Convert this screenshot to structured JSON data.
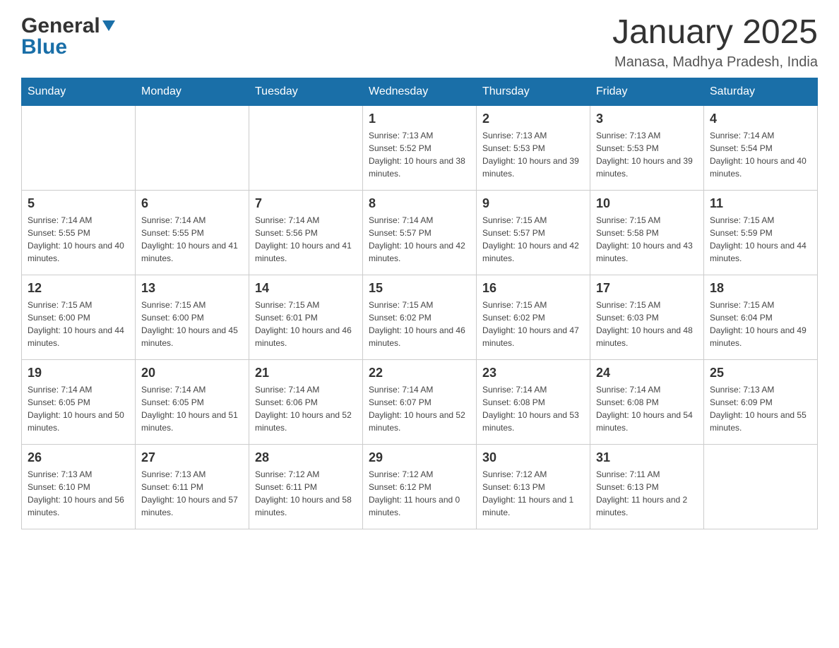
{
  "header": {
    "logo_general": "General",
    "logo_blue": "Blue",
    "month_title": "January 2025",
    "location": "Manasa, Madhya Pradesh, India"
  },
  "weekdays": [
    "Sunday",
    "Monday",
    "Tuesday",
    "Wednesday",
    "Thursday",
    "Friday",
    "Saturday"
  ],
  "weeks": [
    [
      null,
      null,
      null,
      {
        "day": 1,
        "sunrise": "7:13 AM",
        "sunset": "5:52 PM",
        "daylight": "10 hours and 38 minutes."
      },
      {
        "day": 2,
        "sunrise": "7:13 AM",
        "sunset": "5:53 PM",
        "daylight": "10 hours and 39 minutes."
      },
      {
        "day": 3,
        "sunrise": "7:13 AM",
        "sunset": "5:53 PM",
        "daylight": "10 hours and 39 minutes."
      },
      {
        "day": 4,
        "sunrise": "7:14 AM",
        "sunset": "5:54 PM",
        "daylight": "10 hours and 40 minutes."
      }
    ],
    [
      {
        "day": 5,
        "sunrise": "7:14 AM",
        "sunset": "5:55 PM",
        "daylight": "10 hours and 40 minutes."
      },
      {
        "day": 6,
        "sunrise": "7:14 AM",
        "sunset": "5:55 PM",
        "daylight": "10 hours and 41 minutes."
      },
      {
        "day": 7,
        "sunrise": "7:14 AM",
        "sunset": "5:56 PM",
        "daylight": "10 hours and 41 minutes."
      },
      {
        "day": 8,
        "sunrise": "7:14 AM",
        "sunset": "5:57 PM",
        "daylight": "10 hours and 42 minutes."
      },
      {
        "day": 9,
        "sunrise": "7:15 AM",
        "sunset": "5:57 PM",
        "daylight": "10 hours and 42 minutes."
      },
      {
        "day": 10,
        "sunrise": "7:15 AM",
        "sunset": "5:58 PM",
        "daylight": "10 hours and 43 minutes."
      },
      {
        "day": 11,
        "sunrise": "7:15 AM",
        "sunset": "5:59 PM",
        "daylight": "10 hours and 44 minutes."
      }
    ],
    [
      {
        "day": 12,
        "sunrise": "7:15 AM",
        "sunset": "6:00 PM",
        "daylight": "10 hours and 44 minutes."
      },
      {
        "day": 13,
        "sunrise": "7:15 AM",
        "sunset": "6:00 PM",
        "daylight": "10 hours and 45 minutes."
      },
      {
        "day": 14,
        "sunrise": "7:15 AM",
        "sunset": "6:01 PM",
        "daylight": "10 hours and 46 minutes."
      },
      {
        "day": 15,
        "sunrise": "7:15 AM",
        "sunset": "6:02 PM",
        "daylight": "10 hours and 46 minutes."
      },
      {
        "day": 16,
        "sunrise": "7:15 AM",
        "sunset": "6:02 PM",
        "daylight": "10 hours and 47 minutes."
      },
      {
        "day": 17,
        "sunrise": "7:15 AM",
        "sunset": "6:03 PM",
        "daylight": "10 hours and 48 minutes."
      },
      {
        "day": 18,
        "sunrise": "7:15 AM",
        "sunset": "6:04 PM",
        "daylight": "10 hours and 49 minutes."
      }
    ],
    [
      {
        "day": 19,
        "sunrise": "7:14 AM",
        "sunset": "6:05 PM",
        "daylight": "10 hours and 50 minutes."
      },
      {
        "day": 20,
        "sunrise": "7:14 AM",
        "sunset": "6:05 PM",
        "daylight": "10 hours and 51 minutes."
      },
      {
        "day": 21,
        "sunrise": "7:14 AM",
        "sunset": "6:06 PM",
        "daylight": "10 hours and 52 minutes."
      },
      {
        "day": 22,
        "sunrise": "7:14 AM",
        "sunset": "6:07 PM",
        "daylight": "10 hours and 52 minutes."
      },
      {
        "day": 23,
        "sunrise": "7:14 AM",
        "sunset": "6:08 PM",
        "daylight": "10 hours and 53 minutes."
      },
      {
        "day": 24,
        "sunrise": "7:14 AM",
        "sunset": "6:08 PM",
        "daylight": "10 hours and 54 minutes."
      },
      {
        "day": 25,
        "sunrise": "7:13 AM",
        "sunset": "6:09 PM",
        "daylight": "10 hours and 55 minutes."
      }
    ],
    [
      {
        "day": 26,
        "sunrise": "7:13 AM",
        "sunset": "6:10 PM",
        "daylight": "10 hours and 56 minutes."
      },
      {
        "day": 27,
        "sunrise": "7:13 AM",
        "sunset": "6:11 PM",
        "daylight": "10 hours and 57 minutes."
      },
      {
        "day": 28,
        "sunrise": "7:12 AM",
        "sunset": "6:11 PM",
        "daylight": "10 hours and 58 minutes."
      },
      {
        "day": 29,
        "sunrise": "7:12 AM",
        "sunset": "6:12 PM",
        "daylight": "11 hours and 0 minutes."
      },
      {
        "day": 30,
        "sunrise": "7:12 AM",
        "sunset": "6:13 PM",
        "daylight": "11 hours and 1 minute."
      },
      {
        "day": 31,
        "sunrise": "7:11 AM",
        "sunset": "6:13 PM",
        "daylight": "11 hours and 2 minutes."
      },
      null
    ]
  ]
}
